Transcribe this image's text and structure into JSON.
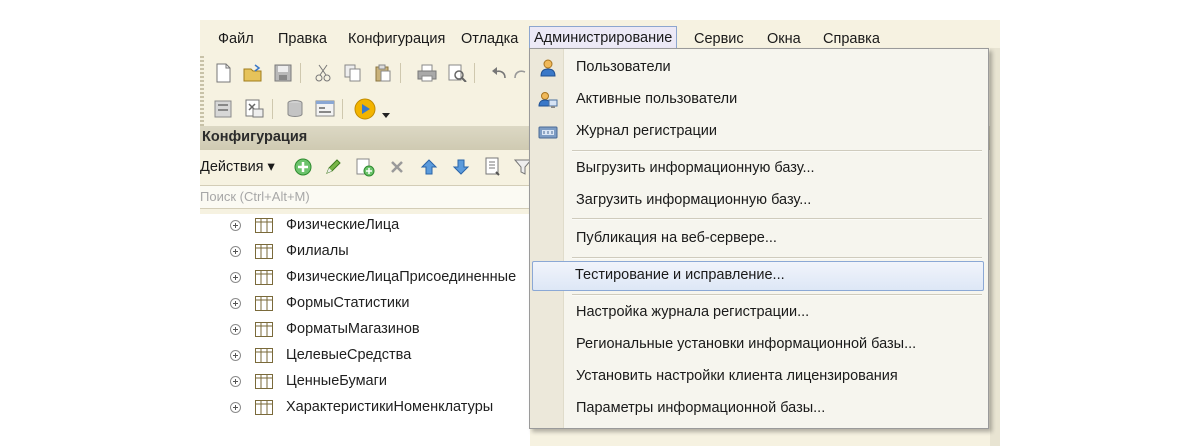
{
  "menu": {
    "items": [
      {
        "label": "Файл"
      },
      {
        "label": "Правка"
      },
      {
        "label": "Конфигурация"
      },
      {
        "label": "Отладка"
      },
      {
        "label": "Администрирование"
      },
      {
        "label": "Сервис"
      },
      {
        "label": "Окна"
      },
      {
        "label": "Справка"
      }
    ],
    "active": "Администрирование"
  },
  "panel": {
    "title": "Конфигурация",
    "actions_label": "Действия ▾",
    "search_placeholder": "Поиск (Ctrl+Alt+M)"
  },
  "tree": {
    "items": [
      {
        "label": "ФизическиеЛица"
      },
      {
        "label": "Филиалы"
      },
      {
        "label": "ФизическиеЛицаПрисоединенные"
      },
      {
        "label": "ФормыСтатистики"
      },
      {
        "label": "ФорматыМагазинов"
      },
      {
        "label": "ЦелевыеСредства"
      },
      {
        "label": "ЦенныеБумаги"
      },
      {
        "label": "ХарактеристикиНоменклатуры"
      }
    ]
  },
  "dropdown": {
    "items": [
      {
        "label": "Пользователи",
        "icon": "user-icon"
      },
      {
        "label": "Активные пользователи",
        "icon": "active-users-icon"
      },
      {
        "label": "Журнал регистрации",
        "icon": "log-icon"
      },
      {
        "label": "Выгрузить информационную базу..."
      },
      {
        "label": "Загрузить информационную базу..."
      },
      {
        "label": "Публикация на веб-сервере..."
      },
      {
        "label": "Тестирование и исправление...",
        "highlighted": true
      },
      {
        "label": "Настройка журнала регистрации..."
      },
      {
        "label": "Региональные установки информационной базы..."
      },
      {
        "label": "Установить настройки клиента лицензирования"
      },
      {
        "label": "Параметры информационной базы..."
      }
    ]
  },
  "colors": {
    "window_bg": "#f6f2e1",
    "menu_active_bg": "#ece9f6",
    "highlight_border": "#8ba8d5",
    "accent_green": "#3aa53a",
    "accent_blue": "#3a78c8"
  }
}
